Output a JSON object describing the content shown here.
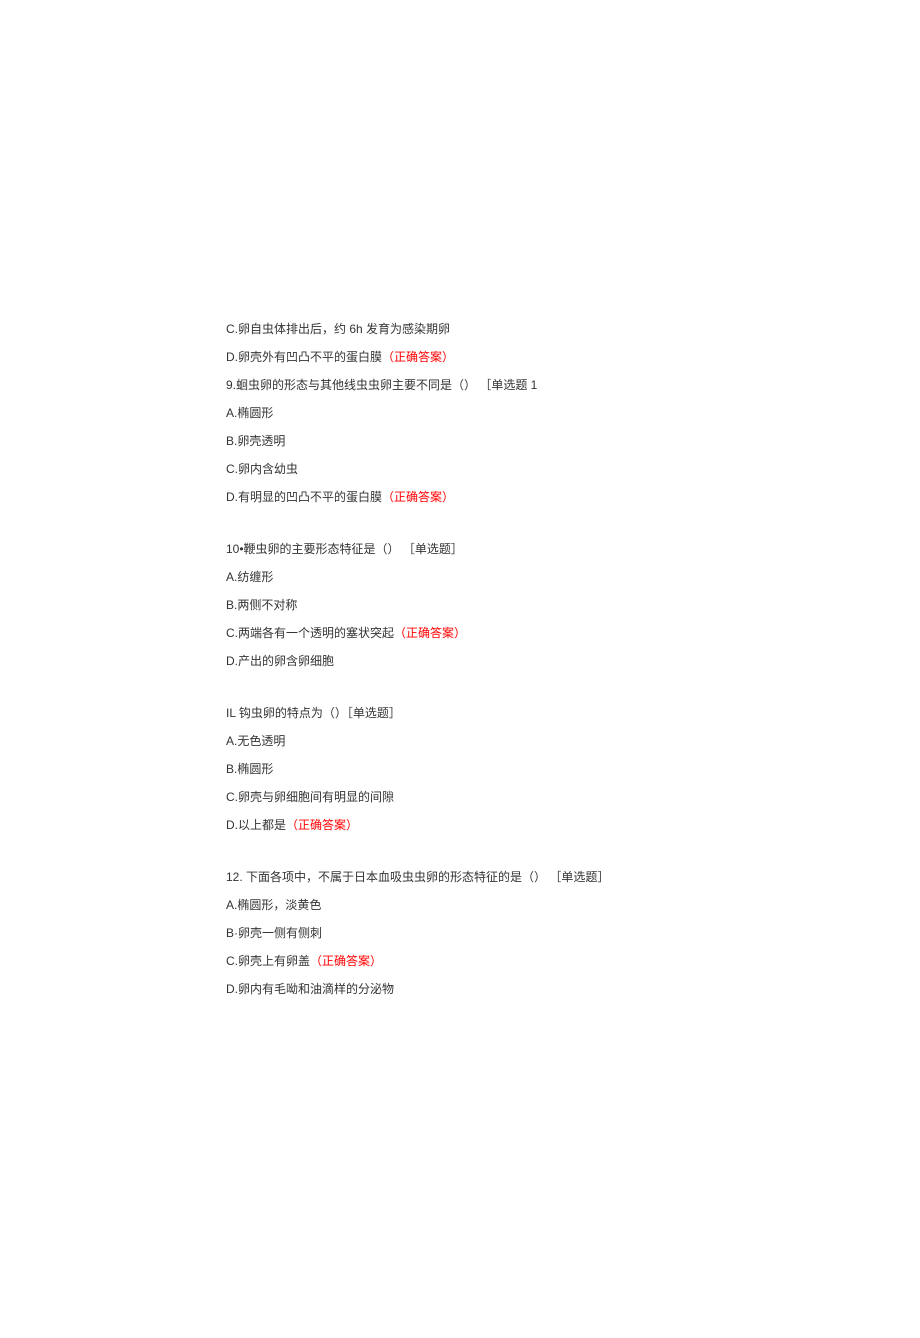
{
  "part8": {
    "options": {
      "c": "C.卵自虫体排出后，约 6h 发育为感染期卵",
      "d_pre": "D.卵壳外有凹凸不平的蛋白膜",
      "d_ans": "（正确答案）"
    }
  },
  "q9": {
    "stem": "9.蛔虫卵的形态与其他线虫虫卵主要不同是（） ［单选题 1",
    "a": "A.椭圆形",
    "b": "B.卵壳透明",
    "c": "C.卵内含幼虫",
    "d_pre": "D.有明显的凹凸不平的蛋白膜",
    "d_ans": "（正确答案）"
  },
  "q10": {
    "stem": "10•鞭虫卵的主要形态特征是（） ［单选题］",
    "a": "A.纺缠形",
    "b": "B.两侧不对称",
    "c_pre": "C.两端各有一个透明的塞状突起",
    "c_ans": "（正确答案）",
    "d": "D.产出的卵含卵细胞"
  },
  "q11": {
    "stem": "IL 钩虫卵的特点为（）［单选题］",
    "a": "A.无色透明",
    "b": "B.椭圆形",
    "c": "C.卵壳与卵细胞间有明显的间隙",
    "d_pre": "D.以上都是",
    "d_ans": "（正确答案）"
  },
  "q12": {
    "stem": "12. 下面各项中，不属于日本血吸虫虫卵的形态特征的是（） ［单选题］",
    "a": "A.椭圆形，淡黄色",
    "b": "B·卵壳一侧有侧刺",
    "c_pre": "C.卵壳上有卵盖",
    "c_ans": "（正确答案）",
    "d": "D.卵内有毛呦和油滴样的分泌物"
  }
}
